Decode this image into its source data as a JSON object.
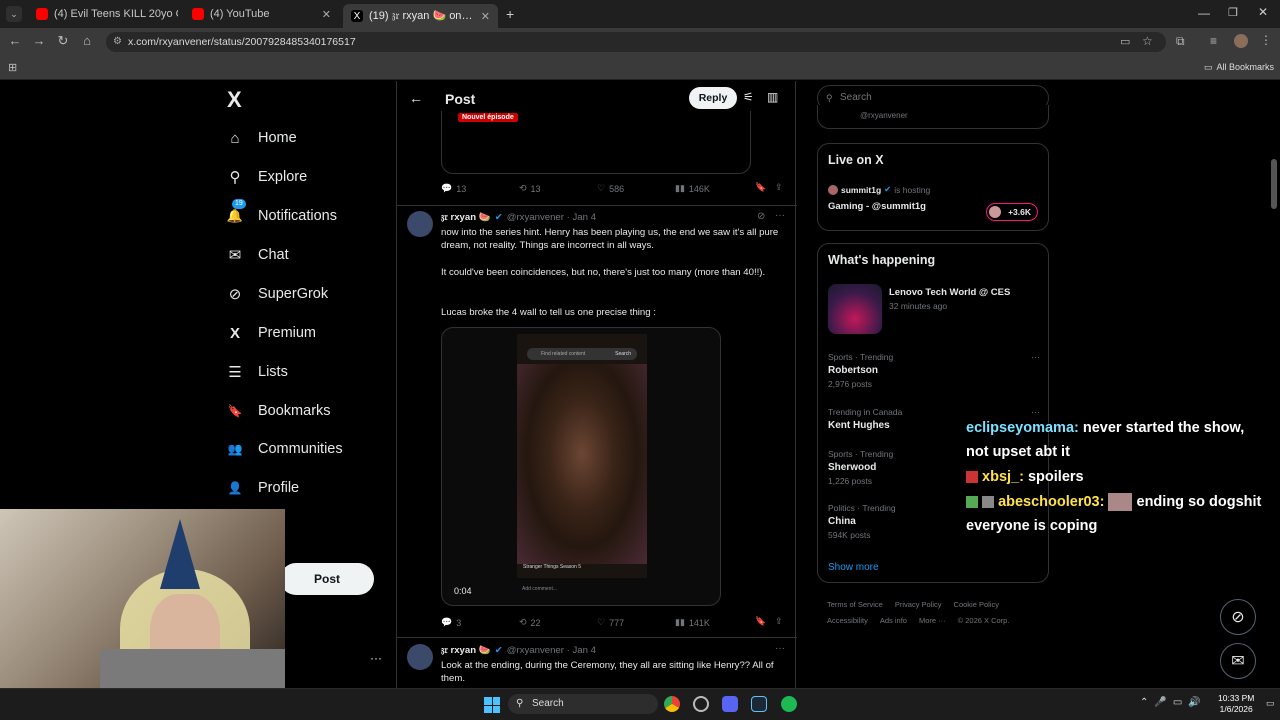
{
  "browser": {
    "tabs": [
      {
        "label": "(4) Evil Teens KILL 20yo Girl For",
        "close": "✕"
      },
      {
        "label": "(4) YouTube",
        "close": "✕"
      },
      {
        "label": "(19) 𝔷𝔯 rxyan 🍉 on X: \"thread ...",
        "close": "✕"
      }
    ],
    "new_tab": "+",
    "url": "x.com/rxyanvener/status/2007928485340176517",
    "all_bookmarks": "All Bookmarks"
  },
  "sidebar": {
    "logo": "X",
    "items": [
      {
        "label": "Home",
        "icon": "⌂"
      },
      {
        "label": "Explore",
        "icon": "⚲"
      },
      {
        "label": "Notifications",
        "icon": "🔔",
        "badge": "19"
      },
      {
        "label": "Chat",
        "icon": "✉"
      },
      {
        "label": "SuperGrok",
        "icon": "⊘"
      },
      {
        "label": "Premium",
        "icon": "X"
      },
      {
        "label": "Lists",
        "icon": "☰"
      },
      {
        "label": "Bookmarks",
        "icon": "🔖"
      },
      {
        "label": "Communities",
        "icon": "👥"
      },
      {
        "label": "Profile",
        "icon": "👤"
      }
    ],
    "post_button": "Post",
    "more_dots": "···"
  },
  "header": {
    "title": "Post",
    "reply_button": "Reply"
  },
  "embedded_label": "Nouvel épisode",
  "tweet0_stats": {
    "replies": "13",
    "reposts": "13",
    "likes": "586",
    "views": "146K"
  },
  "tweet1": {
    "name": "𝔷𝔯 rxyan 🍉",
    "handle": "@rxyanvener · Jan 4",
    "text1": "now into the series hint. Henry has been playing us, the end we saw it's all pure dream, not reality. Things are incorrect in all ways.",
    "text2": "It could've been coincidences, but no, there's just too many (more than 40!!).",
    "text3": "Lucas broke the 4 wall to tell us one precise thing :",
    "video_time": "0:04",
    "phone_search_placeholder": "Find related content",
    "phone_search_btn": "Search",
    "phone_caption": "Stranger Things Season 5",
    "phone_comment": "Add comment...",
    "stats": {
      "replies": "3",
      "reposts": "22",
      "likes": "777",
      "views": "141K"
    }
  },
  "tweet2": {
    "name": "𝔷𝔯 rxyan 🍉",
    "handle": "@rxyanvener · Jan 4",
    "text": "Look at the ending, during the Ceremony, they all are sitting like Henry?? All of them."
  },
  "right": {
    "search_placeholder": "Search",
    "top_handle": "@rxyanvener",
    "live": {
      "title": "Live on X",
      "host": "summit1g",
      "hosting": "is hosting",
      "stream": "Gaming - @summit1g",
      "viewers": "+3.6K"
    },
    "happening": {
      "title": "What's happening",
      "featured": {
        "title": "Lenovo Tech World @ CES",
        "time": "32 minutes ago"
      },
      "trends": [
        {
          "meta": "Sports · Trending",
          "name": "Robertson",
          "count": "2,976 posts"
        },
        {
          "meta": "Trending in Canada",
          "name": "Kent Hughes",
          "count": ""
        },
        {
          "meta": "Sports · Trending",
          "name": "Sherwood",
          "count": "1,226 posts"
        },
        {
          "meta": "Politics · Trending",
          "name": "China",
          "count": "594K posts"
        }
      ],
      "show_more": "Show more"
    },
    "footer": {
      "links": [
        "Terms of Service",
        "Privacy Policy",
        "Cookie Policy",
        "Accessibility",
        "Ads info",
        "More ···",
        "© 2026 X Corp."
      ]
    }
  },
  "chat": {
    "line1_user": "eclipseyomama:",
    "line1_msg": "never started the show,",
    "line1b": "not upset abt it",
    "line2_user": "xbsj_:",
    "line2_msg": "spoilers",
    "line3_user": "abeschooler03:",
    "line3_msg": "ending so dogshit",
    "line3b": "everyone is coping"
  },
  "taskbar": {
    "search": "Search",
    "time": "10:33 PM",
    "date": "1/6/2026"
  },
  "colors": {
    "accent": "#1d9bf0",
    "chat_user": "#7de0ff",
    "chat_user2": "#ffe14d"
  }
}
